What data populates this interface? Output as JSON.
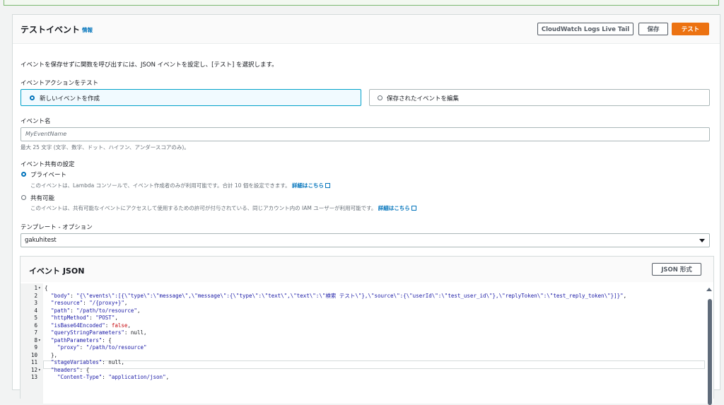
{
  "header": {
    "title": "テストイベント",
    "info": "情報"
  },
  "buttons": {
    "live_tail": "CloudWatch Logs Live Tail",
    "save": "保存",
    "test": "テスト"
  },
  "description": "イベントを保存せずに関数を呼び出すには、JSON イベントを設定し、[テスト] を選択します。",
  "event_action": {
    "label": "イベントアクションをテスト",
    "options": [
      "新しいイベントを作成",
      "保存されたイベントを編集"
    ],
    "selected": "新しいイベントを作成"
  },
  "event_name": {
    "label": "イベント名",
    "placeholder": "MyEventName",
    "hint": "最大 25 文字 (文字、数字、ドット、ハイフン、アンダースコアのみ)。"
  },
  "sharing": {
    "label": "イベント共有の設定",
    "private": {
      "title": "プライベート",
      "desc": "このイベントは、Lambda コンソールで、イベント作成者のみが利用可能です。合計 10 個を設定できます。",
      "link": "詳細はこちら"
    },
    "shareable": {
      "title": "共有可能",
      "desc": "このイベントは、共有可能なイベントにアクセスして使用するための許可が付与されている、同じアカウント内の IAM ユーザーが利用可能です。",
      "link": "詳細はこちら"
    },
    "selected": "プライベート"
  },
  "template": {
    "label": "テンプレート - オプション",
    "value": "gakuhitest"
  },
  "json_panel": {
    "title": "イベント JSON",
    "format_button": "JSON 形式"
  },
  "code_lines": [
    {
      "n": "1",
      "fold": "▾",
      "text": "{"
    },
    {
      "n": "2",
      "fold": "",
      "text": "  \"body\": \"{\\\"events\\\":[{\\\"type\\\":\\\"message\\\",\\\"message\\\":{\\\"type\\\":\\\"text\\\",\\\"text\\\":\\\"検索 テスト\\\"},\\\"source\\\":{\\\"userId\\\":\\\"test_user_id\\\"},\\\"replyToken\\\":\\\"test_reply_token\\\"}]}\","
    },
    {
      "n": "3",
      "fold": "",
      "text": "  \"resource\": \"/{proxy+}\","
    },
    {
      "n": "4",
      "fold": "",
      "text": "  \"path\": \"/path/to/resource\","
    },
    {
      "n": "5",
      "fold": "",
      "text": "  \"httpMethod\": \"POST\","
    },
    {
      "n": "6",
      "fold": "",
      "text": "  \"isBase64Encoded\": false,"
    },
    {
      "n": "7",
      "fold": "",
      "text": "  \"queryStringParameters\": null,"
    },
    {
      "n": "8",
      "fold": "▾",
      "text": "  \"pathParameters\": {"
    },
    {
      "n": "9",
      "fold": "",
      "text": "    \"proxy\": \"/path/to/resource\""
    },
    {
      "n": "10",
      "fold": "",
      "text": "  },"
    },
    {
      "n": "11",
      "fold": "",
      "text": "  \"stageVariables\": null,"
    },
    {
      "n": "12",
      "fold": "▾",
      "text": "  \"headers\": {"
    },
    {
      "n": "13",
      "fold": "",
      "text": "    \"Content-Type\": \"application/json\","
    }
  ]
}
